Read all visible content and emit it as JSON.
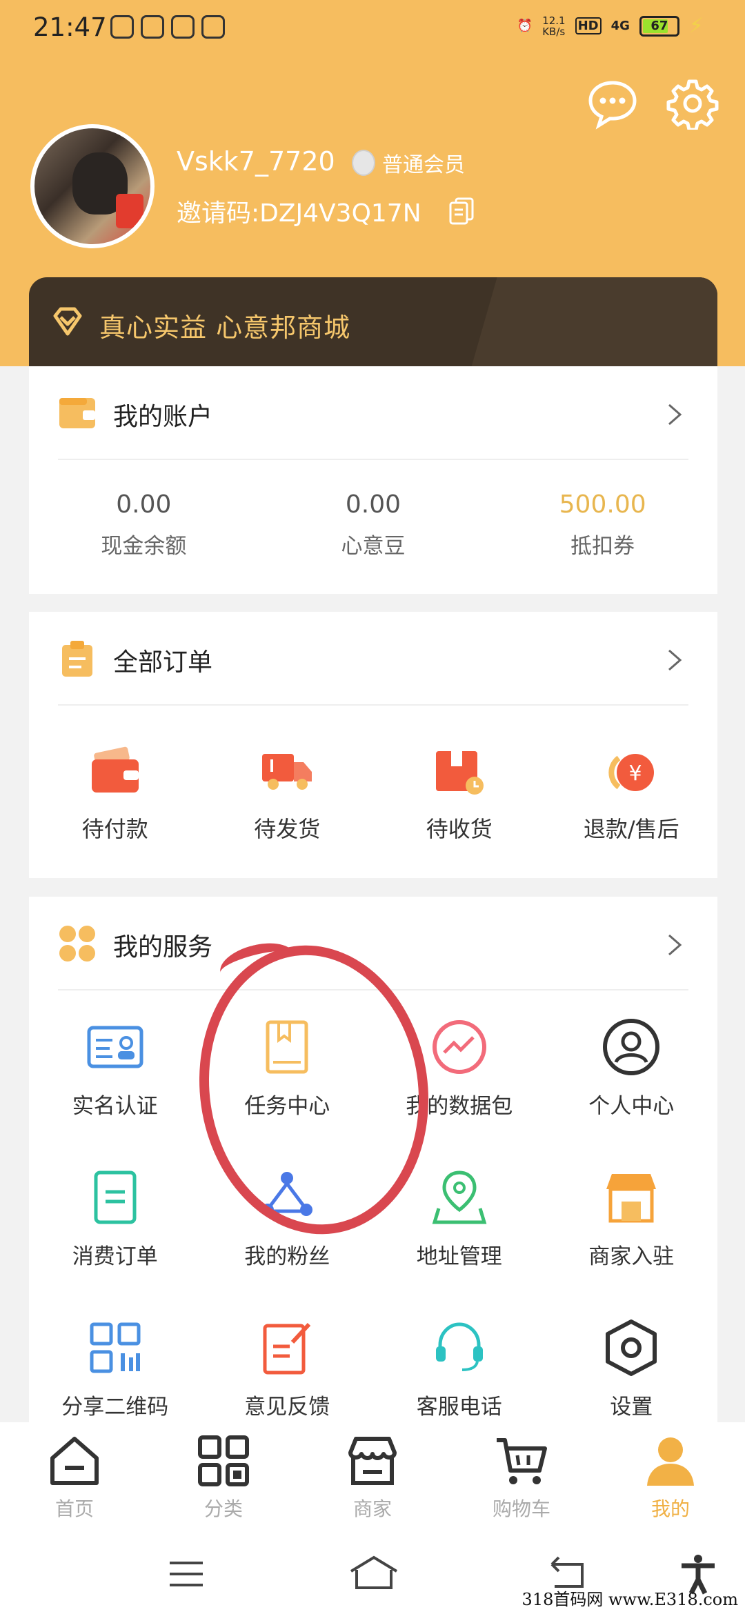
{
  "status_bar": {
    "time": "21:47",
    "speed": "12.1\nKB/s",
    "hd": "HD",
    "network": "4G",
    "battery": "67"
  },
  "profile": {
    "username": "Vskk7_7720",
    "member_level": "普通会员",
    "invite_code": "邀请码:DZJ4V3Q17N"
  },
  "banner": {
    "text": "真心实益 心意邦商城"
  },
  "account": {
    "title": "我的账户",
    "items": [
      {
        "value": "0.00",
        "label": "现金余额"
      },
      {
        "value": "0.00",
        "label": "心意豆"
      },
      {
        "value": "500.00",
        "label": "抵扣券"
      }
    ]
  },
  "orders": {
    "title": "全部订单",
    "items": [
      {
        "label": "待付款",
        "icon": "wallet-icon"
      },
      {
        "label": "待发货",
        "icon": "truck-icon"
      },
      {
        "label": "待收货",
        "icon": "package-icon"
      },
      {
        "label": "退款/售后",
        "icon": "refund-icon"
      }
    ]
  },
  "services": {
    "title": "我的服务",
    "items": [
      {
        "label": "实名认证",
        "icon": "id-card-icon"
      },
      {
        "label": "任务中心",
        "icon": "task-book-icon"
      },
      {
        "label": "我的数据包",
        "icon": "data-chart-icon"
      },
      {
        "label": "个人中心",
        "icon": "person-icon"
      },
      {
        "label": "消费订单",
        "icon": "receipt-icon"
      },
      {
        "label": "我的粉丝",
        "icon": "fans-network-icon"
      },
      {
        "label": "地址管理",
        "icon": "location-map-icon"
      },
      {
        "label": "商家入驻",
        "icon": "storefront-icon"
      },
      {
        "label": "分享二维码",
        "icon": "qrcode-icon"
      },
      {
        "label": "意见反馈",
        "icon": "feedback-edit-icon"
      },
      {
        "label": "客服电话",
        "icon": "headset-icon"
      },
      {
        "label": "设置",
        "icon": "hex-settings-icon"
      }
    ]
  },
  "nav": {
    "items": [
      {
        "label": "首页",
        "icon": "home-icon"
      },
      {
        "label": "分类",
        "icon": "category-grid-icon"
      },
      {
        "label": "商家",
        "icon": "shop-icon"
      },
      {
        "label": "购物车",
        "icon": "cart-icon"
      },
      {
        "label": "我的",
        "icon": "user-icon",
        "active": true
      }
    ]
  },
  "watermark": "318首码网 www.E318.com",
  "colors": {
    "header": "#f6bd5f",
    "accent": "#f0b044",
    "banner": "#3f3326",
    "annotation": "#d9474f"
  }
}
